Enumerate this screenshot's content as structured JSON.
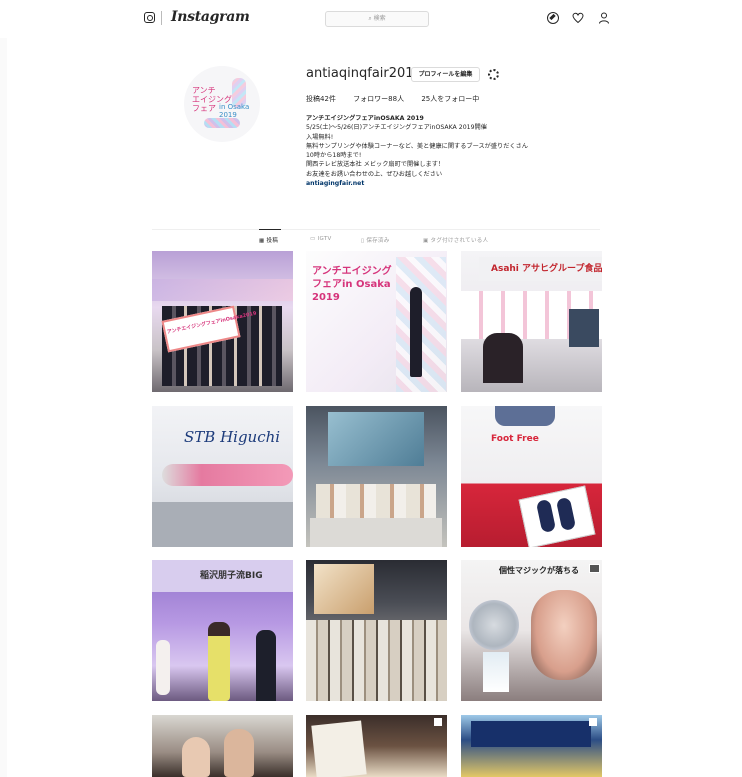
{
  "nav": {
    "logo": "Instagram",
    "search_placeholder": "検索"
  },
  "profile": {
    "username": "antiaqinqfair2019",
    "edit_button": "プロフィールを編集",
    "stats": {
      "posts": "投稿42件",
      "followers": "フォロワー88人",
      "following": "25人をフォロー中"
    },
    "bio": {
      "name": "アンチエイジングフェアinOSAKA 2019",
      "lines": [
        "5/25(土)～5/26(日)アンチエイジングフェアinOSAKA 2019開催",
        "入場無料!",
        "無料サンプリングや体験コーナーなど、美と健康に関するブースが盛りだくさん",
        "10時から18時まで!",
        "関西テレビ放送本社 メビック扇町で開催します！",
        "お友達をお誘い合わせの上、ぜひお越しください"
      ],
      "link": "antiagingfair.net"
    },
    "avatar_text": {
      "line1": "アンチ",
      "line2": "エイジング",
      "line3": "フェア",
      "line4": "in Osaka 2019"
    }
  },
  "tabs": [
    {
      "label": "投稿"
    },
    {
      "label": "IGTV"
    },
    {
      "label": "保存済み"
    },
    {
      "label": "タグ付けされている人"
    }
  ],
  "posts": [
    {
      "caption": "アンチエイジングフェアinOsaka2019"
    },
    {
      "caption": "アンチエイジングフェアin Osaka 2019"
    },
    {
      "caption": "Asahi アサヒグループ食品"
    },
    {
      "caption": "STB Higuchi"
    },
    {
      "caption": ""
    },
    {
      "caption": "Foot Free"
    },
    {
      "caption": "稲沢朋子流BIG"
    },
    {
      "caption": ""
    },
    {
      "caption": "個性マジックが落ちる"
    }
  ],
  "colors": {
    "accent_link": "#003569",
    "border": "#dbdbdb",
    "text": "#262626"
  }
}
